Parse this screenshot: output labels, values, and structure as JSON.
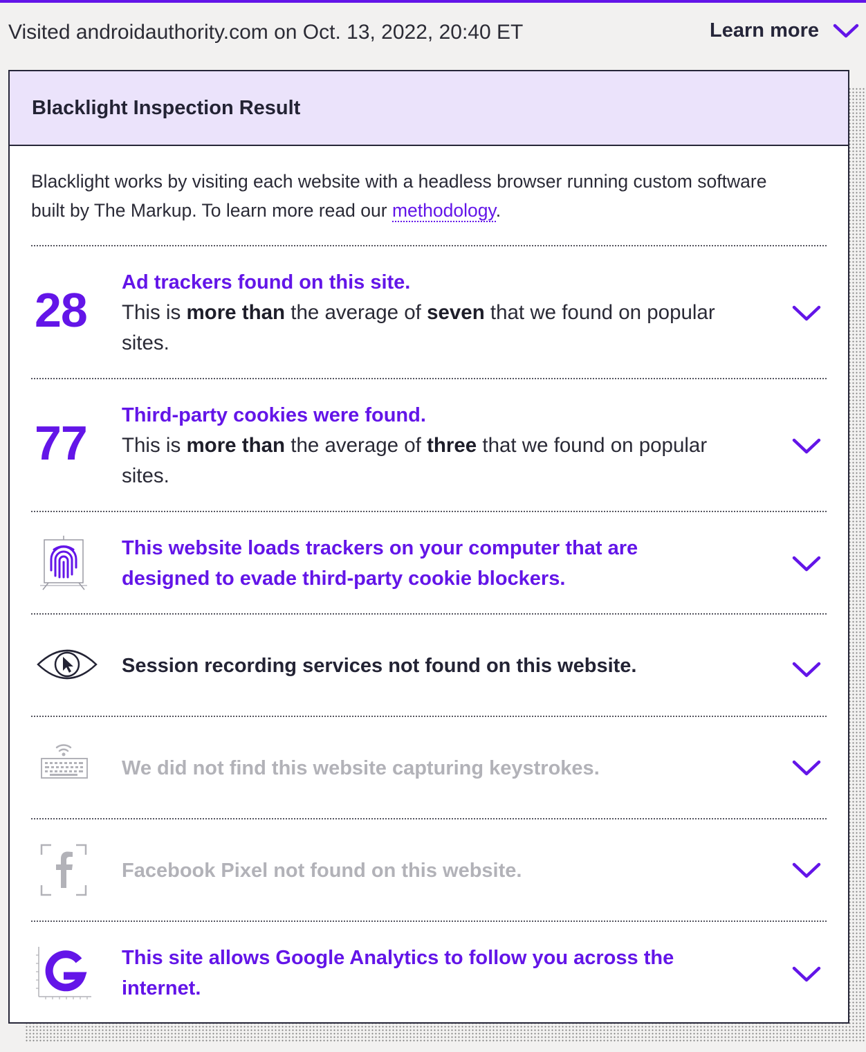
{
  "visit": {
    "text": "Visited androidauthority.com on Oct. 13, 2022, 20:40 ET",
    "learn_more": "Learn more"
  },
  "panel": {
    "title": "Blacklight Inspection Result",
    "intro_before": "Blacklight works by visiting each website with a headless browser running custom software built by The Markup. To learn more read our ",
    "intro_link": "methodology",
    "intro_after": "."
  },
  "results": {
    "ad_trackers": {
      "count": "28",
      "title": "Ad trackers found on this site.",
      "desc_1": "This is ",
      "desc_bold_1": "more than",
      "desc_2": " the average of ",
      "desc_bold_2": "seven",
      "desc_3": " that we found on popular sites."
    },
    "cookies": {
      "count": "77",
      "title": "Third-party cookies were found.",
      "desc_1": "This is ",
      "desc_bold_1": "more than",
      "desc_2": " the average of ",
      "desc_bold_2": "three",
      "desc_3": " that we found on popular sites."
    },
    "fingerprinting": {
      "title": "This website loads trackers on your computer that are designed to evade third-party cookie blockers."
    },
    "session_recording": {
      "title": "Session recording services not found on this website."
    },
    "keystrokes": {
      "title": "We did not find this website capturing keystrokes."
    },
    "facebook_pixel": {
      "title": "Facebook Pixel not found on this website."
    },
    "google_analytics": {
      "title": "This site allows Google Analytics to follow you across the internet."
    }
  },
  "colors": {
    "accent": "#6315e8",
    "header_bg": "#ebe3fb",
    "muted": "#b2b2b8",
    "dark": "#232334"
  },
  "icons": {
    "learn_more": "chevron-down-icon",
    "fingerprint": "fingerprint-icon",
    "session": "eye-cursor-icon",
    "keystrokes": "keyboard-icon",
    "facebook": "facebook-icon",
    "google": "google-icon",
    "expand": "chevron-down-icon"
  }
}
